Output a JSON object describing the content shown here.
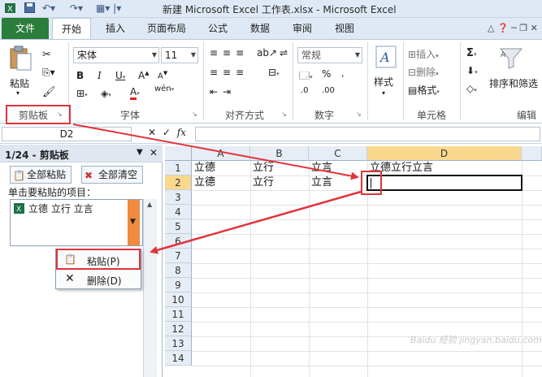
{
  "window": {
    "title": "新建 Microsoft Excel 工作表.xlsx - Microsoft Excel"
  },
  "tabs": [
    "文件",
    "开始",
    "插入",
    "页面布局",
    "公式",
    "数据",
    "审阅",
    "视图"
  ],
  "ribbon": {
    "clipboard": {
      "paste_label": "粘贴",
      "group_label": "剪贴板"
    },
    "font": {
      "font_name": "宋体",
      "font_size": "11",
      "group_label": "字体"
    },
    "alignment": {
      "group_label": "对齐方式"
    },
    "number": {
      "format": "常规",
      "group_label": "数字"
    },
    "styles": {
      "label": "样式"
    },
    "cells": {
      "insert_label": "插入",
      "delete_label": "删除",
      "format_label": "格式",
      "group_label": "单元格"
    },
    "editing": {
      "sort_label": "排序和筛选",
      "group_label": "编辑"
    }
  },
  "formula_bar": {
    "name_box": "D2",
    "cancel": "✕",
    "enter": "✓",
    "fx": "fx",
    "value": ""
  },
  "clipboard_pane": {
    "title": "1/24 - 剪贴板",
    "paste_all": "全部粘贴",
    "clear_all": "全部清空",
    "hint": "单击要粘贴的项目：",
    "items": [
      "立德 立行 立言"
    ]
  },
  "context_menu": {
    "paste": "粘贴(P)",
    "delete": "删除(D)"
  },
  "sheet": {
    "columns": [
      "A",
      "B",
      "C",
      "D"
    ],
    "rows": [
      "1",
      "2",
      "3",
      "4",
      "5",
      "6",
      "7",
      "8",
      "9",
      "10",
      "11",
      "12",
      "13",
      "14"
    ],
    "cells": {
      "A1": "立德",
      "B1": "立行",
      "C1": "立言",
      "D1": "立德立行立言",
      "A2": "立德",
      "B2": "立行",
      "C2": "立言"
    },
    "active_cell": "D2"
  },
  "watermark": "Baidu 经验 jingyan.baidu.com",
  "colors": {
    "file_tab": "#2a7d3b",
    "annotation_red": "#e1333a",
    "item_dropdown": "#f08a3c"
  }
}
